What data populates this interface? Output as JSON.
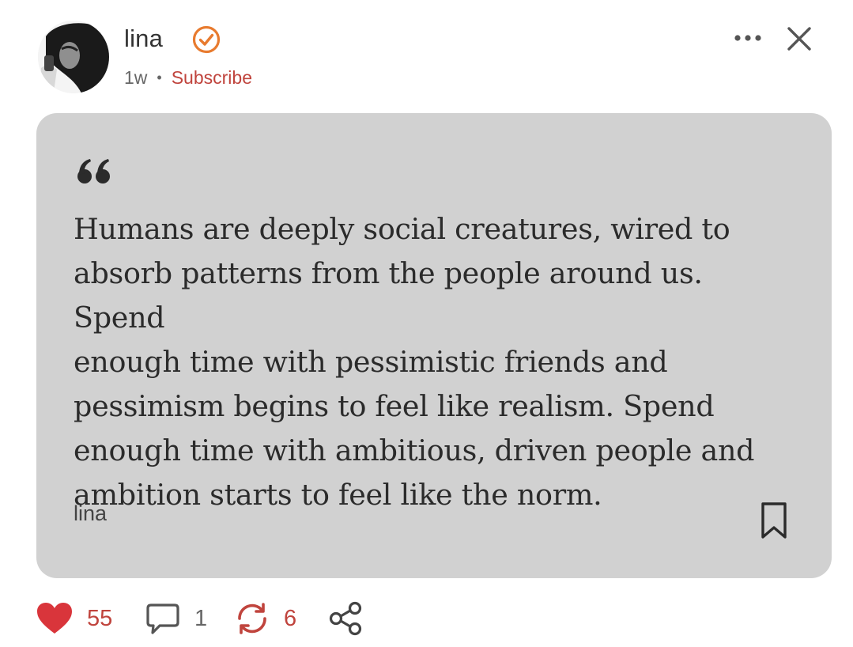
{
  "header": {
    "author_name": "lina",
    "timestamp": "1w",
    "separator": "•",
    "subscribe_label": "Subscribe",
    "verified_icon": "verified-check-badge",
    "more_icon": "more-horizontal",
    "close_icon": "close-x"
  },
  "quote": {
    "mark": "“",
    "text": "Humans are deeply social creatures, wired to\nabsorb patterns from the people around us.  Spend\nenough time with pessimistic friends and\npessimism begins to feel like realism. Spend\nenough time with ambitious, driven people and\nambition starts to feel like the norm.",
    "author": "lina",
    "bookmark_icon": "bookmark-outline"
  },
  "actions": {
    "likes": "55",
    "comments": "1",
    "restacks": "6",
    "like_icon": "heart-filled",
    "comment_icon": "speech-bubble",
    "restack_icon": "restack-arrows",
    "share_icon": "share-nodes"
  },
  "colors": {
    "accent": "#c0443d",
    "verified": "#e87b2f",
    "card_bg": "#d1d1d1",
    "heart": "#d9353b"
  }
}
